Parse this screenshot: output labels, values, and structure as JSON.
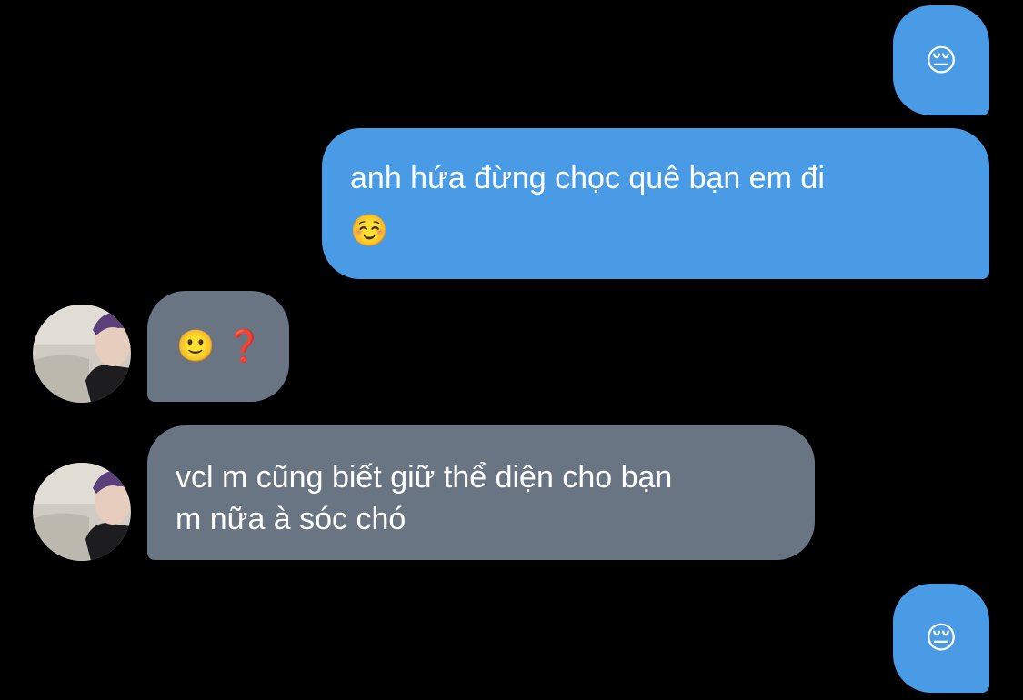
{
  "colors": {
    "background": "#000000",
    "outgoing_bubble": "#4a9be6",
    "incoming_bubble": "#6a7584",
    "text": "#ffffff"
  },
  "messages": [
    {
      "sender": "me",
      "text": "😔"
    },
    {
      "sender": "me",
      "text": "anh hứa đừng chọc quê bạn em đi",
      "emoji": "☺️"
    },
    {
      "sender": "contact",
      "text": "🙂 ❓",
      "avatar_icon": "avatar-photo"
    },
    {
      "sender": "contact",
      "text_line1": "vcl m cũng biết giữ thể diện cho bạn",
      "text_line2": "m nữa à sóc chó",
      "avatar_icon": "avatar-photo"
    },
    {
      "sender": "me",
      "text": "😔"
    }
  ]
}
